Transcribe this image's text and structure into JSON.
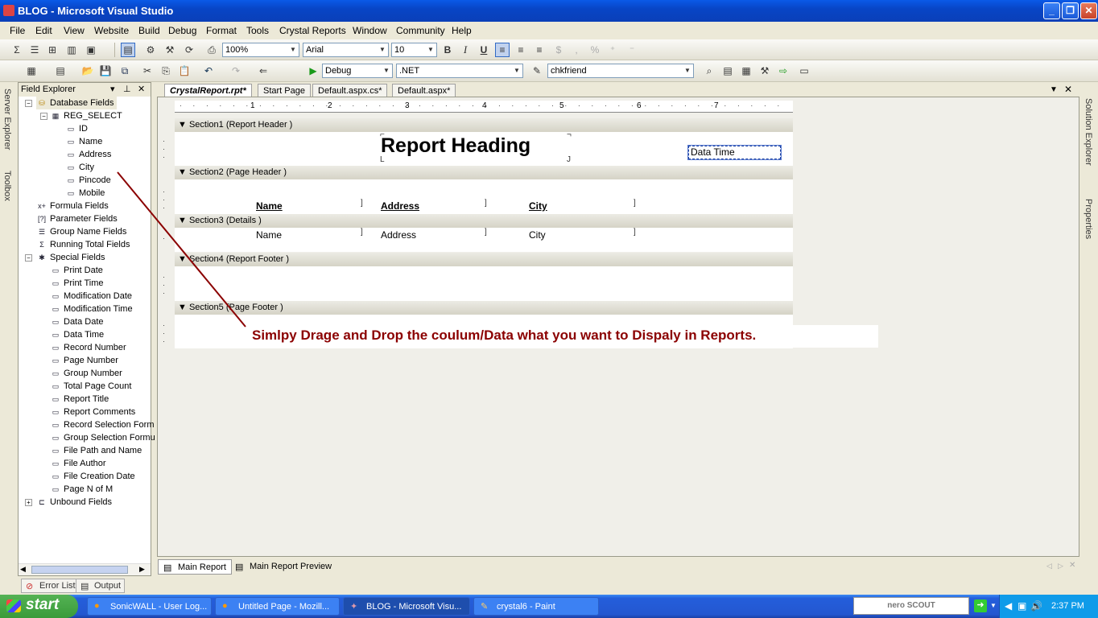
{
  "window": {
    "title": "BLOG - Microsoft Visual Studio"
  },
  "menu": [
    "File",
    "Edit",
    "View",
    "Website",
    "Build",
    "Debug",
    "Format",
    "Tools",
    "Crystal Reports",
    "Window",
    "Community",
    "Help"
  ],
  "toolbar1": {
    "zoom": "100%",
    "font": "Arial",
    "size": "10",
    "bold": "B",
    "italic": "I",
    "underline": "U",
    "currency": "$",
    "percent": "%"
  },
  "toolbar2": {
    "config": "Debug",
    "platform": ".NET",
    "find": "chkfriend"
  },
  "rails": {
    "left_top": "Server Explorer",
    "left_bottom": "Toolbox",
    "right_top": "Solution Explorer",
    "right_bottom": "Properties"
  },
  "field_explorer": {
    "title": "Field Explorer",
    "database_fields": "Database Fields",
    "table": "REG_SELECT",
    "columns": [
      "ID",
      "Name",
      "Address",
      "City",
      "Pincode",
      "Mobile"
    ],
    "groups": [
      "Formula Fields",
      "Parameter Fields",
      "Group Name Fields",
      "Running Total Fields",
      "Special Fields"
    ],
    "special": [
      "Print Date",
      "Print Time",
      "Modification Date",
      "Modification Time",
      "Data Date",
      "Data Time",
      "Record Number",
      "Page Number",
      "Group Number",
      "Total Page Count",
      "Report Title",
      "Report Comments",
      "Record Selection Form",
      "Group Selection Formu",
      "File Path and Name",
      "File Author",
      "File Creation Date",
      "Page N of M"
    ],
    "unbound": "Unbound Fields"
  },
  "tabs": [
    "CrystalReport.rpt*",
    "Start Page",
    "Default.aspx.cs*",
    "Default.aspx*"
  ],
  "ruler": [
    "1",
    "2",
    "3",
    "4",
    "5",
    "6",
    "7"
  ],
  "report": {
    "sections": [
      "Section1 (Report Header  )",
      "Section2 (Page Header  )",
      "Section3 (Details  )",
      "Section4 (Report Footer  )",
      "Section5 (Page Footer  )"
    ],
    "heading": "Report Heading",
    "datetime": "Data Time",
    "headers": [
      "Name",
      "Address",
      "City"
    ],
    "details": [
      "Name",
      "Address",
      "City"
    ]
  },
  "annotation": "Simlpy Drage and Drop the coulum/Data what you want to Dispaly in Reports.",
  "bottom_tabs": [
    "Main Report",
    "Main Report Preview"
  ],
  "output_tabs": [
    "Error List",
    "Output"
  ],
  "taskbar": {
    "start": "start",
    "tasks": [
      "SonicWALL - User Log...",
      "Untitled Page - Mozill...",
      "BLOG - Microsoft Visu...",
      "crystal6 - Paint"
    ],
    "nero": "nero SCOUT",
    "clock": "2:37 PM"
  },
  "colors": {
    "accent": "#0a5ae8",
    "annotation": "#8b0000",
    "arrow": "#8b0000"
  }
}
